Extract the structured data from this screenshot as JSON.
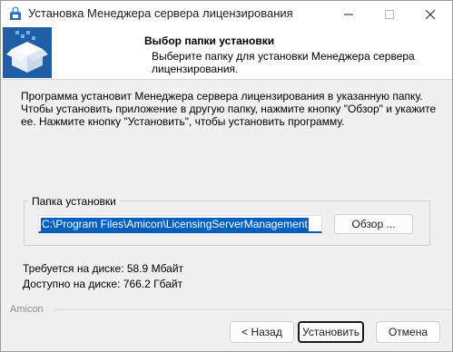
{
  "window": {
    "title": "Установка Менеджера сервера лицензирования"
  },
  "header": {
    "title": "Выбор папки установки",
    "subtitle": "Выберите папку для установки Менеджера сервера лицензирования."
  },
  "description": "Программа установит Менеджера сервера лицензирования в указанную папку. Чтобы установить приложение в другую папку, нажмите кнопку \"Обзор\" и укажите ее. Нажмите кнопку \"Установить\", чтобы установить программу.",
  "install_folder": {
    "group_label": "Папка установки",
    "path": "C:\\Program Files\\Amicon\\LicensingServerManagement",
    "browse_label": "Обзор ..."
  },
  "disk": {
    "required": "Требуется на диске: 58.9 Мбайт",
    "available": "Доступно на диске: 766.2 Гбайт"
  },
  "footer": {
    "brand": "Amicon",
    "back_label": "< Назад",
    "install_label": "Установить",
    "cancel_label": "Отмена"
  },
  "icons": {
    "app": "installer-icon",
    "header": "package-box-icon",
    "minimize": "minimize-icon",
    "maximize": "maximize-icon",
    "close": "close-icon"
  },
  "colors": {
    "accent": "#005fb8",
    "selection": "#0060c0",
    "box_blue": "#1d5fa8"
  }
}
